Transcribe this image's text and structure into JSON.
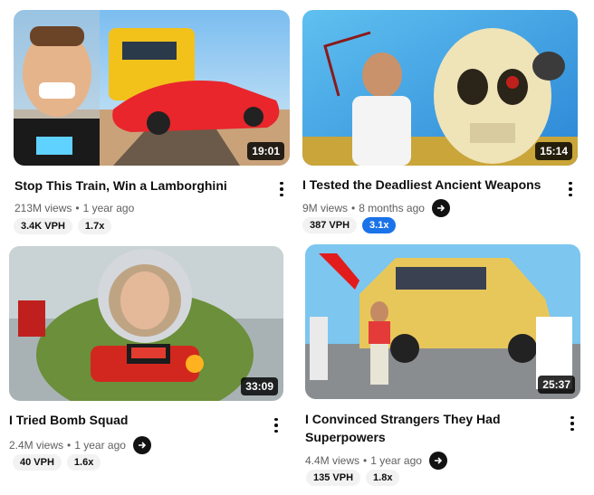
{
  "videos": [
    {
      "title": "Stop This Train, Win a Lamborghini",
      "views": "213M views",
      "age": "1 year ago",
      "duration": "19:01",
      "vph": "3.4K VPH",
      "multiplier": "1.7x",
      "has_ext_icon": false
    },
    {
      "title": "I Tested the Deadliest Ancient Weapons",
      "views": "9M views",
      "age": "8 months ago",
      "duration": "15:14",
      "vph": "387 VPH",
      "multiplier": "3.1x",
      "has_ext_icon": true
    },
    {
      "title": "I Tried Bomb Squad",
      "views": "2.4M views",
      "age": "1 year ago",
      "duration": "33:09",
      "vph": "40 VPH",
      "multiplier": "1.6x",
      "has_ext_icon": true
    },
    {
      "title": "I Convinced Strangers They Had Superpowers",
      "views": "4.4M views",
      "age": "1 year ago",
      "duration": "25:37",
      "vph": "135 VPH",
      "multiplier": "1.8x",
      "has_ext_icon": true
    }
  ],
  "icons": {
    "menu": "more-vert-icon",
    "extension": "arrow-right-circle-icon"
  },
  "colors": {
    "highlight_badge": "#1a73e8",
    "duration_bg": "#000000"
  }
}
